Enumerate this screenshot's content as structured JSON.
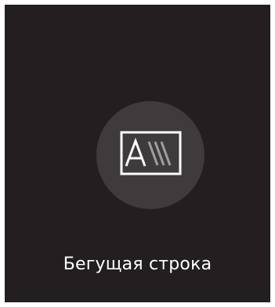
{
  "tile": {
    "label": "Бегущая строка",
    "icon": "ticker-text-icon",
    "colors": {
      "background": "#231f20",
      "icon_circle": "#3f3b3c",
      "icon_stroke": "#ffffff",
      "icon_stripes": "#9e9e9e",
      "label_text": "#ffffff"
    }
  }
}
